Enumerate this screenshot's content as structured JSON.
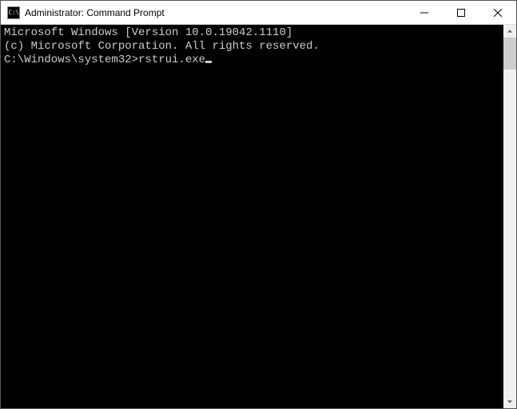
{
  "titlebar": {
    "icon_text": "C:\\",
    "title": "Administrator: Command Prompt"
  },
  "terminal": {
    "header_line1": "Microsoft Windows [Version 10.0.19042.1110]",
    "header_line2": "(c) Microsoft Corporation. All rights reserved.",
    "blank": "",
    "prompt": "C:\\Windows\\system32>",
    "command": "rstrui.exe"
  }
}
